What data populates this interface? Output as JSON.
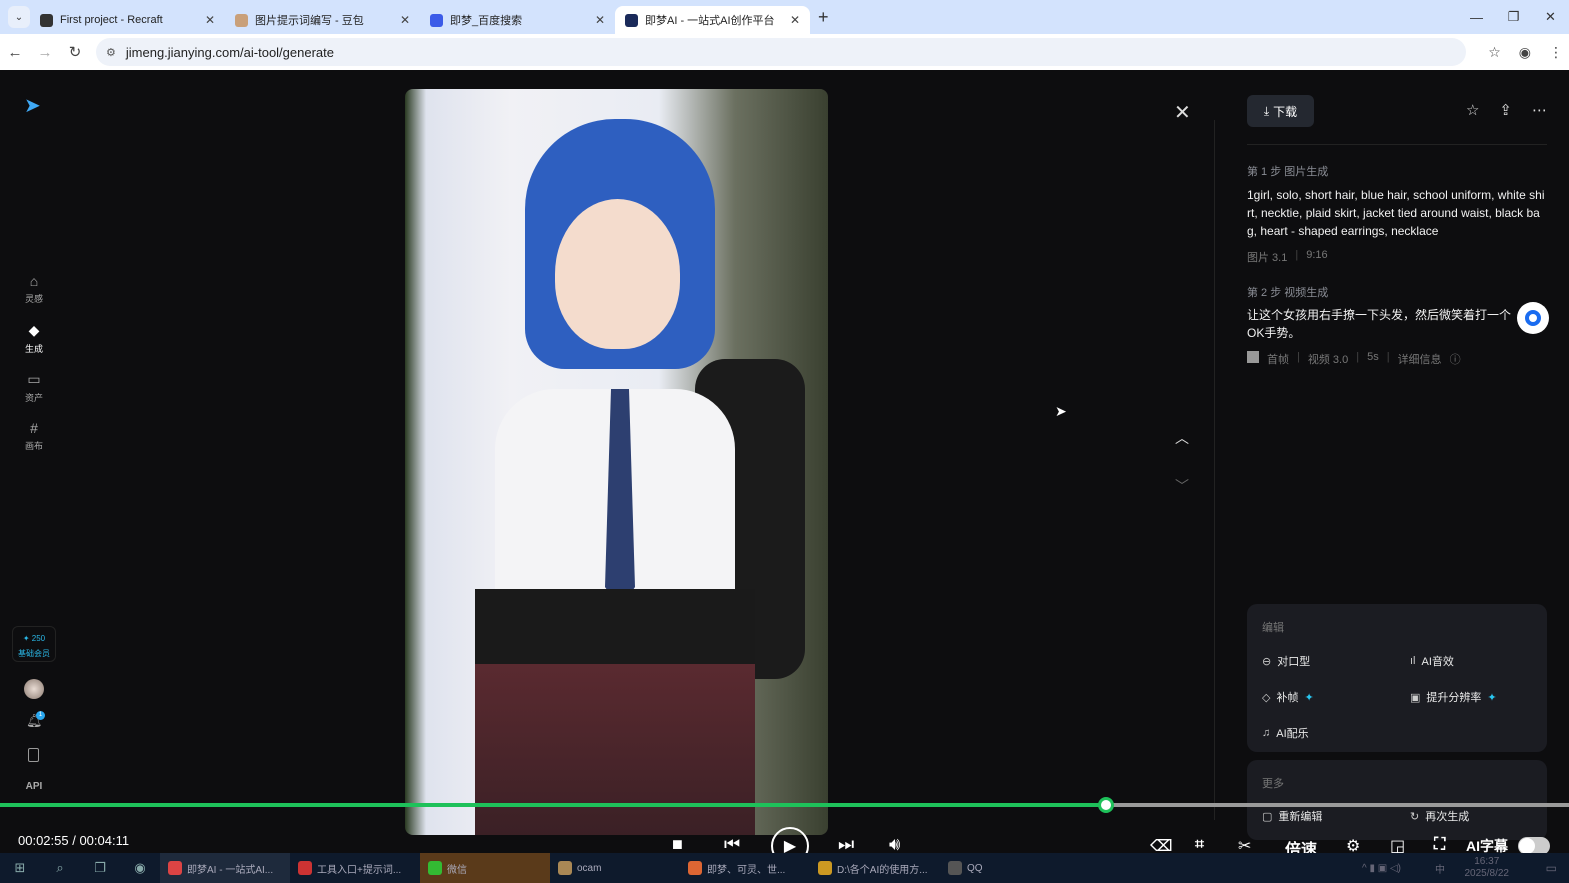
{
  "browser": {
    "tabs": [
      {
        "title": "First project - Recraft",
        "active": false
      },
      {
        "title": "图片提示词编写 - 豆包",
        "active": false
      },
      {
        "title": "即梦_百度搜索",
        "active": false
      },
      {
        "title": "即梦AI - 一站式AI创作平台",
        "active": true
      }
    ],
    "url": "jimeng.jianying.com/ai-tool/generate"
  },
  "sidebar": {
    "items": [
      {
        "label": "灵感",
        "icon": "home-icon"
      },
      {
        "label": "生成",
        "icon": "diamond-icon",
        "active": true
      },
      {
        "label": "资产",
        "icon": "folder-icon"
      },
      {
        "label": "画布",
        "icon": "canvas-icon"
      }
    ],
    "credits": "✦ 250",
    "membership": "基础会员",
    "notification_count": "1",
    "api": "API"
  },
  "panel": {
    "download": "下载",
    "step1": {
      "label": "第 1 步 图片生成",
      "prompt": "1girl, solo, short hair, blue hair, school uniform, white shirt, necktie, plaid skirt, jacket tied around waist, black bag, heart - shaped earrings, necklace",
      "model": "图片 3.1",
      "ratio": "9:16"
    },
    "step2": {
      "label": "第 2 步 视频生成",
      "prompt": "让这个女孩用右手撩一下头发，然后微笑着打一个OK手势。",
      "frame": "首帧",
      "model": "视频 3.0",
      "duration": "5s",
      "details": "详细信息"
    },
    "edit": {
      "title": "编辑",
      "options": [
        {
          "label": "对口型",
          "icon": "lip-sync-icon"
        },
        {
          "label": "AI音效",
          "icon": "sound-effect-icon"
        },
        {
          "label": "补帧",
          "icon": "frame-interp-icon",
          "premium": true
        },
        {
          "label": "提升分辨率",
          "icon": "hd-icon",
          "premium": true
        },
        {
          "label": "AI配乐",
          "icon": "music-icon"
        }
      ]
    },
    "more": {
      "title": "更多",
      "options": [
        {
          "label": "重新编辑",
          "icon": "edit-icon"
        },
        {
          "label": "再次生成",
          "icon": "regenerate-icon"
        }
      ]
    }
  },
  "player": {
    "current": "00:02:55",
    "total": "00:04:11",
    "time_display": "00:02:55 / 00:04:11",
    "progress": 0.705,
    "speed": "倍速",
    "subtitle": "AI字幕",
    "subtitle_on": false
  },
  "taskbar": {
    "items": [
      "即梦AI - 一站式AI...",
      "工具入口+提示词...",
      "微信",
      "ocam",
      "即梦、可灵、世...",
      "D:\\各个AI的使用方...",
      "QQ"
    ],
    "time": "16:37",
    "date": "2025/8/22",
    "ime": "中"
  }
}
